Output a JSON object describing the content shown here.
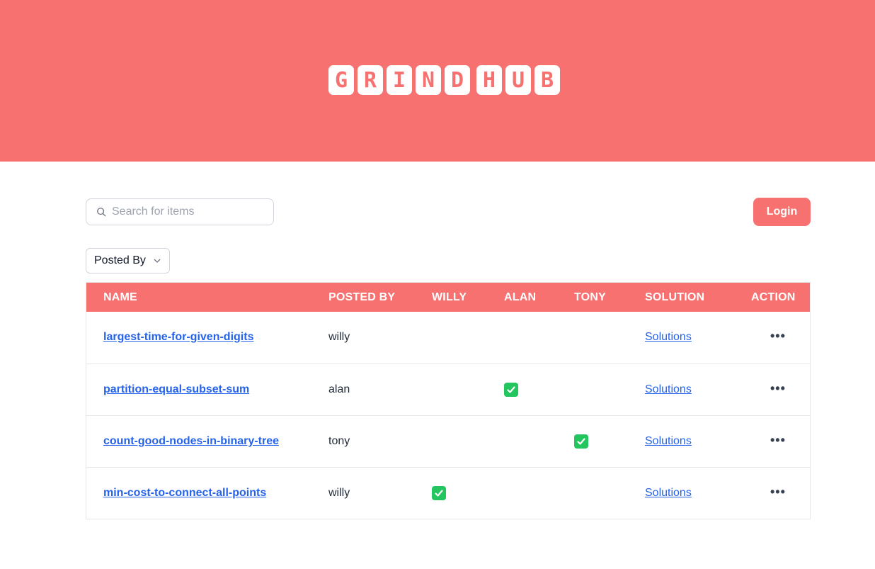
{
  "brand": {
    "letters_1": [
      "G",
      "R",
      "I",
      "N",
      "D"
    ],
    "letters_2": [
      "H",
      "U",
      "B"
    ],
    "accent": "#f87171"
  },
  "search": {
    "placeholder": "Search for items",
    "icon": "search-icon"
  },
  "login_label": "Login",
  "filter": {
    "label": "Posted By",
    "icon": "chevron-down-icon"
  },
  "table": {
    "headers": [
      "NAME",
      "POSTED BY",
      "WILLY",
      "ALAN",
      "TONY",
      "SOLUTION",
      "ACTION"
    ],
    "rows": [
      {
        "name": "largest-time-for-given-digits",
        "posted_by": "willy",
        "willy": false,
        "alan": false,
        "tony": false,
        "solution": "Solutions",
        "action": "•••"
      },
      {
        "name": "partition-equal-subset-sum",
        "posted_by": "alan",
        "willy": false,
        "alan": true,
        "tony": false,
        "solution": "Solutions",
        "action": "•••"
      },
      {
        "name": "count-good-nodes-in-binary-tree",
        "posted_by": "tony",
        "willy": false,
        "alan": false,
        "tony": true,
        "solution": "Solutions",
        "action": "•••"
      },
      {
        "name": "min-cost-to-connect-all-points",
        "posted_by": "willy",
        "willy": true,
        "alan": false,
        "tony": false,
        "solution": "Solutions",
        "action": "•••"
      }
    ]
  }
}
